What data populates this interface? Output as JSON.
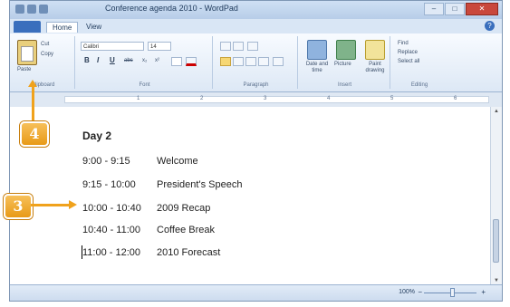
{
  "window": {
    "title": "Conference agenda 2010 - WordPad",
    "controls": {
      "minimize": "–",
      "maximize": "□",
      "close": "✕"
    }
  },
  "tabs": [
    {
      "label": "Home",
      "active": true
    },
    {
      "label": "View",
      "active": false
    }
  ],
  "help_icon": "?",
  "ribbon": {
    "clipboard": {
      "paste": "Paste",
      "cut": "Cut",
      "copy": "Copy",
      "label": "Clipboard"
    },
    "font": {
      "family": "Calibri",
      "size": "14",
      "bold": "B",
      "italic": "I",
      "underline": "U",
      "strike": "abc",
      "subscript": "x₂",
      "superscript": "x²",
      "label": "Font"
    },
    "paragraph": {
      "label": "Paragraph"
    },
    "insert": {
      "picture_date": "Date and time",
      "picture": "Picture",
      "paint": "Paint drawing",
      "label": "Insert"
    },
    "editing": {
      "find": "Find",
      "replace": "Replace",
      "select_all": "Select all",
      "label": "Editing"
    }
  },
  "ruler": {
    "ticks": [
      "1",
      "2",
      "3",
      "4",
      "5",
      "6"
    ]
  },
  "document": {
    "heading": "Day 2",
    "rows": [
      {
        "time": "9:00 - 9:15",
        "item": "Welcome"
      },
      {
        "time": "9:15 - 10:00",
        "item": "President's Speech"
      },
      {
        "time": "10:00 - 10:40",
        "item": "2009 Recap"
      },
      {
        "time": "10:40 - 11:00",
        "item": "Coffee Break"
      },
      {
        "time": "11:00 - 12:00",
        "item": "2010 Forecast"
      }
    ]
  },
  "status": {
    "zoom": "100%",
    "zoom_minus": "−",
    "zoom_plus": "+"
  },
  "callouts": {
    "step3": "3",
    "step4": "4"
  },
  "colors": {
    "accent": "#f0a21c",
    "ribbon": "#dde8f5"
  }
}
